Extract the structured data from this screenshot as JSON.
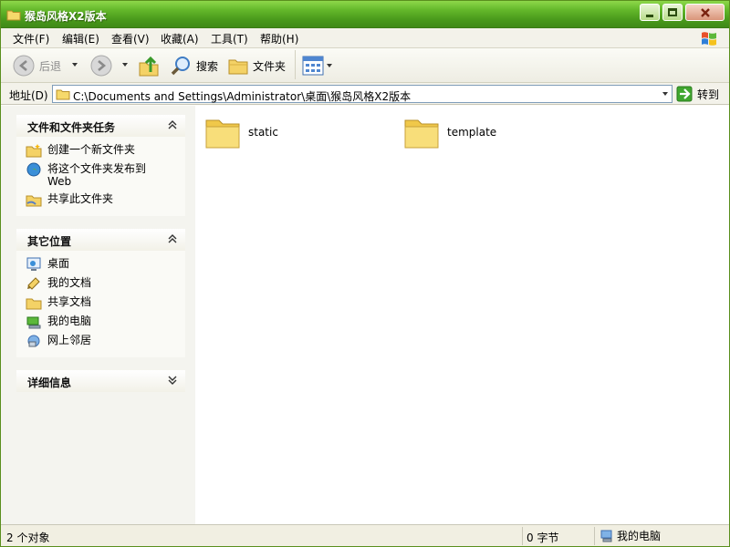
{
  "window": {
    "title": "猴岛风格X2版本"
  },
  "menubar": {
    "items": [
      "文件(F)",
      "编辑(E)",
      "查看(V)",
      "收藏(A)",
      "工具(T)",
      "帮助(H)"
    ]
  },
  "toolbar": {
    "back_label": "后退",
    "search_label": "搜索",
    "folders_label": "文件夹"
  },
  "address": {
    "label": "地址(D)",
    "path": "C:\\Documents and Settings\\Administrator\\桌面\\猴岛风格X2版本",
    "go_label": "转到"
  },
  "taskpane": {
    "file_tasks": {
      "title": "文件和文件夹任务",
      "items": [
        "创建一个新文件夹",
        "将这个文件夹发布到 Web",
        "共享此文件夹"
      ]
    },
    "other_places": {
      "title": "其它位置",
      "items": [
        "桌面",
        "我的文档",
        "共享文档",
        "我的电脑",
        "网上邻居"
      ]
    },
    "details": {
      "title": "详细信息"
    }
  },
  "files": [
    {
      "name": "static"
    },
    {
      "name": "template"
    }
  ],
  "statusbar": {
    "objects": "2 个对象",
    "size": "0 字节",
    "location": "我的电脑"
  }
}
